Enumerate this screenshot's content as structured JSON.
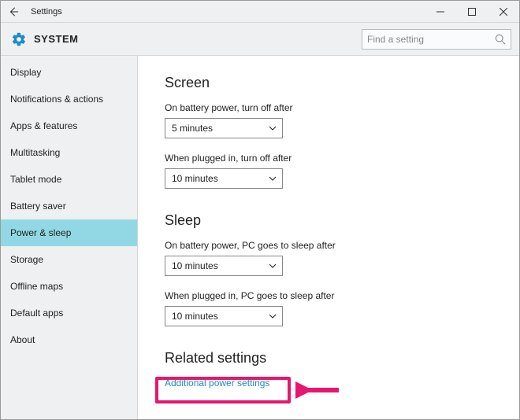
{
  "window": {
    "title": "Settings"
  },
  "header": {
    "category": "SYSTEM"
  },
  "search": {
    "placeholder": "Find a setting"
  },
  "sidebar": {
    "items": [
      {
        "label": "Display"
      },
      {
        "label": "Notifications & actions"
      },
      {
        "label": "Apps & features"
      },
      {
        "label": "Multitasking"
      },
      {
        "label": "Tablet mode"
      },
      {
        "label": "Battery saver"
      },
      {
        "label": "Power & sleep"
      },
      {
        "label": "Storage"
      },
      {
        "label": "Offline maps"
      },
      {
        "label": "Default apps"
      },
      {
        "label": "About"
      }
    ],
    "selected_index": 6
  },
  "main": {
    "screen": {
      "title": "Screen",
      "battery_label": "On battery power, turn off after",
      "battery_value": "5 minutes",
      "plugged_label": "When plugged in, turn off after",
      "plugged_value": "10 minutes"
    },
    "sleep": {
      "title": "Sleep",
      "battery_label": "On battery power, PC goes to sleep after",
      "battery_value": "10 minutes",
      "plugged_label": "When plugged in, PC goes to sleep after",
      "plugged_value": "10 minutes"
    },
    "related": {
      "title": "Related settings",
      "link": "Additional power settings"
    }
  },
  "annotation": {
    "color": "#e6176e"
  }
}
